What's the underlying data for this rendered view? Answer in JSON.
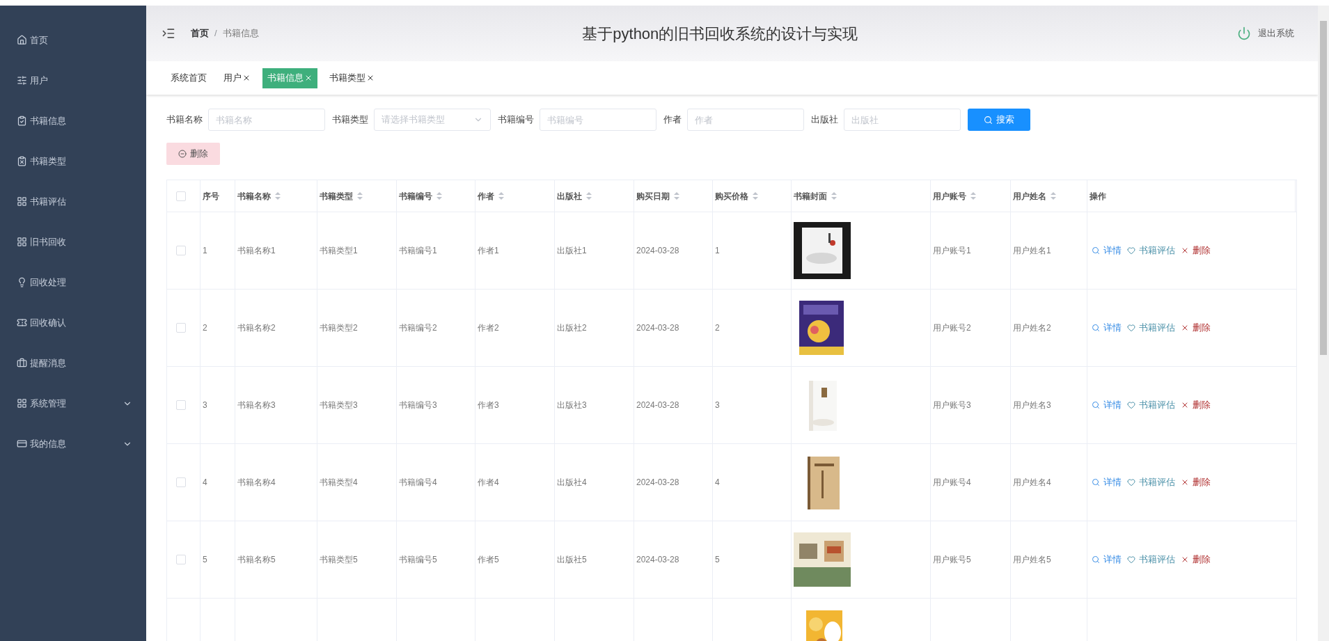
{
  "sidebar": {
    "items": [
      {
        "label": "首页",
        "expandable": false
      },
      {
        "label": "用户",
        "expandable": false
      },
      {
        "label": "书籍信息",
        "expandable": false
      },
      {
        "label": "书籍类型",
        "expandable": false
      },
      {
        "label": "书籍评估",
        "expandable": false
      },
      {
        "label": "旧书回收",
        "expandable": false
      },
      {
        "label": "回收处理",
        "expandable": false
      },
      {
        "label": "回收确认",
        "expandable": false
      },
      {
        "label": "提醒消息",
        "expandable": false
      },
      {
        "label": "系统管理",
        "expandable": true
      },
      {
        "label": "我的信息",
        "expandable": true
      }
    ]
  },
  "header": {
    "breadcrumb": [
      "首页",
      "书籍信息"
    ],
    "breadcrumb_separator": "/",
    "title": "基于python的旧书回收系统的设计与实现",
    "logout": "退出系统"
  },
  "tabs": [
    {
      "label": "系统首页",
      "closable": false,
      "selected": false
    },
    {
      "label": "用户",
      "closable": true,
      "selected": false
    },
    {
      "label": "书籍信息",
      "closable": true,
      "selected": true
    },
    {
      "label": "书籍类型",
      "closable": true,
      "selected": false
    }
  ],
  "search": {
    "fields": [
      {
        "label": "书籍名称",
        "placeholder": "书籍名称",
        "kind": "input"
      },
      {
        "label": "书籍类型",
        "placeholder": "请选择书籍类型",
        "kind": "select"
      },
      {
        "label": "书籍编号",
        "placeholder": "书籍编号",
        "kind": "input"
      },
      {
        "label": "作者",
        "placeholder": "作者",
        "kind": "input"
      },
      {
        "label": "出版社",
        "placeholder": "出版社",
        "kind": "input"
      }
    ],
    "button": "搜索"
  },
  "delete_button": "删除",
  "table": {
    "select_all": {
      "checked": false
    },
    "columns": [
      {
        "label": "序号",
        "sortable": false
      },
      {
        "label": "书籍名称",
        "sortable": true
      },
      {
        "label": "书籍类型",
        "sortable": true
      },
      {
        "label": "书籍编号",
        "sortable": true
      },
      {
        "label": "作者",
        "sortable": true
      },
      {
        "label": "出版社",
        "sortable": true
      },
      {
        "label": "购买日期",
        "sortable": true
      },
      {
        "label": "购买价格",
        "sortable": true
      },
      {
        "label": "书籍封面",
        "sortable": true
      },
      {
        "label": "用户账号",
        "sortable": true
      },
      {
        "label": "用户姓名",
        "sortable": true
      },
      {
        "label": "操作",
        "sortable": false
      }
    ],
    "rows": [
      {
        "checked": false,
        "cells": [
          "1",
          "书籍名称1",
          "书籍类型1",
          "书籍编号1",
          "作者1",
          "出版社1",
          "2024-03-28",
          "1"
        ],
        "cover": {
          "kind": "picture"
        },
        "user_cells": [
          "用户账号1",
          "用户姓名1"
        ],
        "actions": [
          "详情",
          "书籍评估",
          "删除"
        ]
      },
      {
        "checked": false,
        "cells": [
          "2",
          "书籍名称2",
          "书籍类型2",
          "书籍编号2",
          "作者2",
          "出版社2",
          "2024-03-28",
          "2"
        ],
        "cover": {
          "kind": "picture"
        },
        "user_cells": [
          "用户账号2",
          "用户姓名2"
        ],
        "actions": [
          "详情",
          "书籍评估",
          "删除"
        ]
      },
      {
        "checked": false,
        "cells": [
          "3",
          "书籍名称3",
          "书籍类型3",
          "书籍编号3",
          "作者3",
          "出版社3",
          "2024-03-28",
          "3"
        ],
        "cover": {
          "kind": "picture"
        },
        "user_cells": [
          "用户账号3",
          "用户姓名3"
        ],
        "actions": [
          "详情",
          "书籍评估",
          "删除"
        ]
      },
      {
        "checked": false,
        "cells": [
          "4",
          "书籍名称4",
          "书籍类型4",
          "书籍编号4",
          "作者4",
          "出版社4",
          "2024-03-28",
          "4"
        ],
        "cover": {
          "kind": "picture"
        },
        "user_cells": [
          "用户账号4",
          "用户姓名4"
        ],
        "actions": [
          "详情",
          "书籍评估",
          "删除"
        ]
      },
      {
        "checked": false,
        "cells": [
          "5",
          "书籍名称5",
          "书籍类型5",
          "书籍编号5",
          "作者5",
          "出版社5",
          "2024-03-28",
          "5"
        ],
        "cover": {
          "kind": "picture"
        },
        "user_cells": [
          "用户账号5",
          "用户姓名5"
        ],
        "actions": [
          "详情",
          "书籍评估",
          "删除"
        ]
      }
    ],
    "partial_row": {
      "cover": {
        "kind": "picture"
      }
    }
  }
}
